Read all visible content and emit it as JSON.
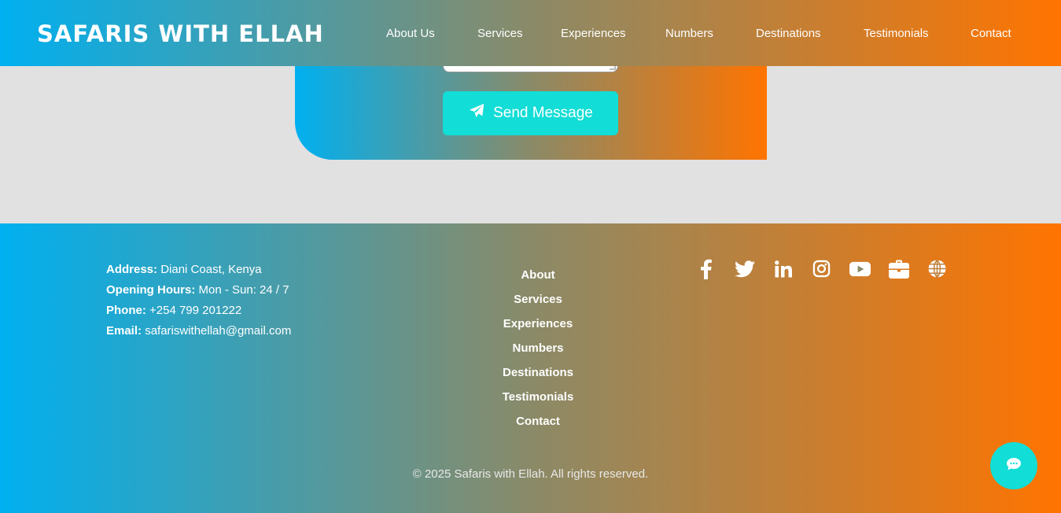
{
  "header": {
    "brand": "SAFARIS WITH ELLAH",
    "nav": [
      "About Us",
      "Services",
      "Experiences",
      "Numbers",
      "Destinations",
      "Testimonials",
      "Contact"
    ]
  },
  "form": {
    "send_label": "Send Message",
    "send_icon": "paper-plane-icon"
  },
  "footer": {
    "contact": [
      {
        "label": "Address:",
        "value": "Diani Coast, Kenya"
      },
      {
        "label": "Opening Hours:",
        "value": "Mon - Sun: 24 / 7"
      },
      {
        "label": "Phone:",
        "value": "+254 799 201222"
      },
      {
        "label": "Email:",
        "value": "safariswithellah@gmail.com"
      }
    ],
    "links": [
      "About",
      "Services",
      "Experiences",
      "Numbers",
      "Destinations",
      "Testimonials",
      "Contact"
    ],
    "social_icons": [
      "facebook-icon",
      "twitter-icon",
      "linkedin-icon",
      "instagram-icon",
      "youtube-icon",
      "briefcase-icon",
      "globe-icon"
    ],
    "copyright": "© 2025 Safaris with Ellah. All rights reserved."
  },
  "chat": {
    "icon": "chat-bubble-icon"
  },
  "colors": {
    "gradient_start": "#00b0f0",
    "gradient_end": "#ff7400",
    "accent": "#12ddd6",
    "page_bg": "#e1e1e1"
  }
}
